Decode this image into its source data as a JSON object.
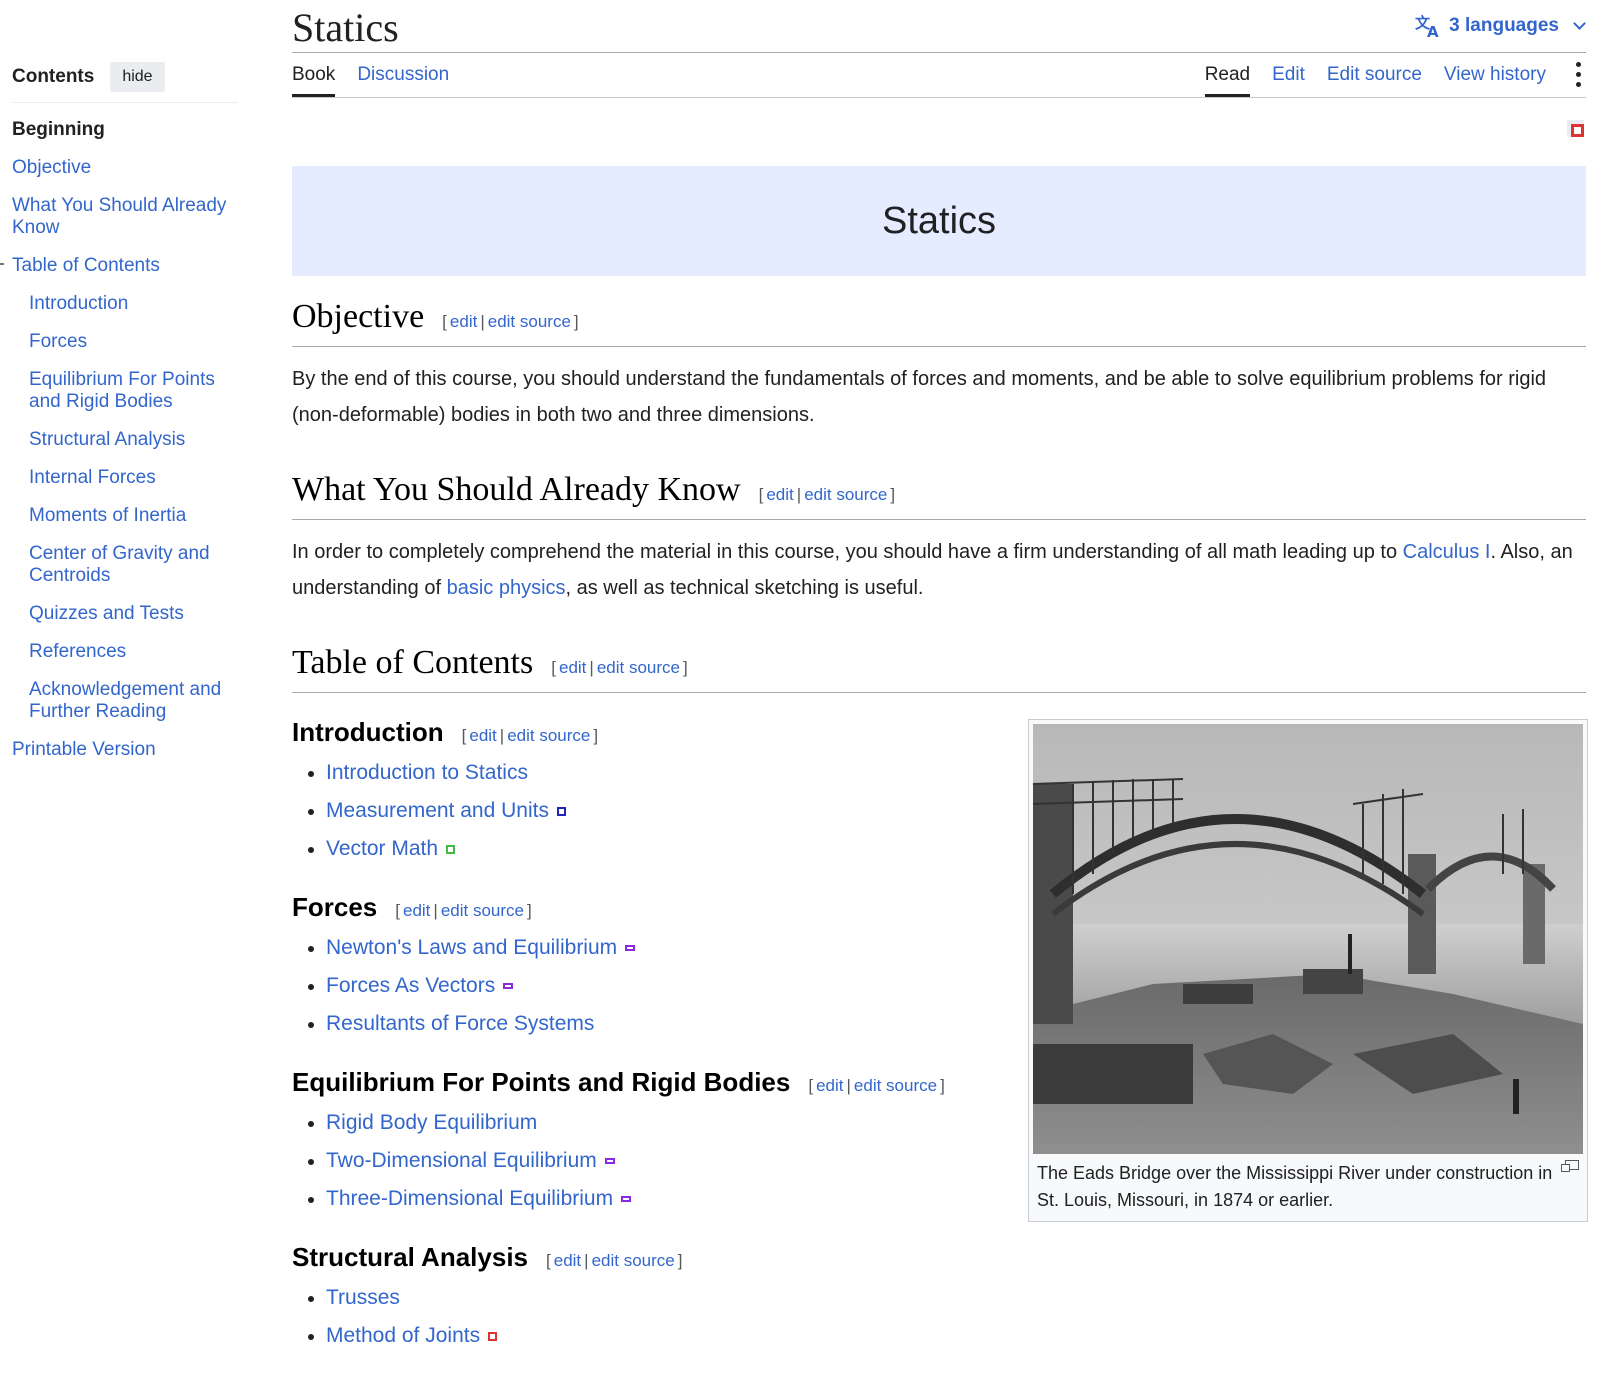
{
  "page": {
    "title": "Statics",
    "languages_label": "3 languages"
  },
  "tabs": {
    "left": [
      "Book",
      "Discussion"
    ],
    "right": [
      "Read",
      "Edit",
      "Edit source",
      "View history"
    ]
  },
  "sidebar": {
    "title": "Contents",
    "hide_label": "hide",
    "items": [
      {
        "label": "Beginning",
        "level": 1,
        "active": true
      },
      {
        "label": "Objective",
        "level": 1
      },
      {
        "label": "What You Should Already Know",
        "level": 1
      },
      {
        "label": "Table of Contents",
        "level": 1
      },
      {
        "label": "Introduction",
        "level": 2
      },
      {
        "label": "Forces",
        "level": 2
      },
      {
        "label": "Equilibrium For Points and Rigid Bodies",
        "level": 2
      },
      {
        "label": "Structural Analysis",
        "level": 2
      },
      {
        "label": "Internal Forces",
        "level": 2
      },
      {
        "label": "Moments of Inertia",
        "level": 2
      },
      {
        "label": "Center of Gravity and Centroids",
        "level": 2
      },
      {
        "label": "Quizzes and Tests",
        "level": 2
      },
      {
        "label": "References",
        "level": 2
      },
      {
        "label": "Acknowledgement and Further Reading",
        "level": 2
      },
      {
        "label": "Printable Version",
        "level": 1
      }
    ]
  },
  "banner": {
    "title": "Statics"
  },
  "edit_links": {
    "open": "[",
    "edit": "edit",
    "sep": "|",
    "edit_source": "edit source",
    "close": "]"
  },
  "sections": {
    "objective": {
      "heading": "Objective",
      "text": "By the end of this course, you should understand the fundamentals of forces and moments, and be able to solve equilibrium problems for rigid (non-deformable) bodies in both two and three dimensions."
    },
    "know": {
      "heading": "What You Should Already Know",
      "text_1": "In order to completely comprehend the material in this course, you should have a firm understanding of all math leading up to",
      "link_1": "Calculus I",
      "text_2": ". Also, an understanding of",
      "link_2": "basic physics",
      "text_3": ", as well as technical sketching is useful."
    },
    "toc": {
      "heading": "Table of Contents"
    },
    "introduction": {
      "heading": "Introduction",
      "items": [
        {
          "label": "Introduction to Statics",
          "badge_color": ""
        },
        {
          "label": "Measurement and Units",
          "badge_color": "#2222bb"
        },
        {
          "label": "Vector Math",
          "badge_color": "#44bb44"
        }
      ]
    },
    "forces": {
      "heading": "Forces",
      "items": [
        {
          "label": "Newton's Laws and Equilibrium",
          "badge_color": "#8a2be2"
        },
        {
          "label": "Forces As Vectors",
          "badge_color": "#8a2be2"
        },
        {
          "label": "Resultants of Force Systems",
          "badge_color": ""
        }
      ]
    },
    "equilibrium": {
      "heading": "Equilibrium For Points and Rigid Bodies",
      "items": [
        {
          "label": "Rigid Body Equilibrium",
          "badge_color": ""
        },
        {
          "label": "Two-Dimensional Equilibrium",
          "badge_color": "#8a2be2"
        },
        {
          "label": "Three-Dimensional Equilibrium",
          "badge_color": "#8a2be2"
        }
      ]
    },
    "structural": {
      "heading": "Structural Analysis",
      "items": [
        {
          "label": "Trusses",
          "badge_color": ""
        },
        {
          "label": "Method of Joints",
          "badge_color": "#dd3333"
        }
      ]
    }
  },
  "figure": {
    "caption": "The Eads Bridge over the Mississippi River under construction in St. Louis, Missouri, in 1874 or earlier."
  },
  "colors": {
    "link": "#3366cc",
    "banner": "#e6ecff"
  }
}
